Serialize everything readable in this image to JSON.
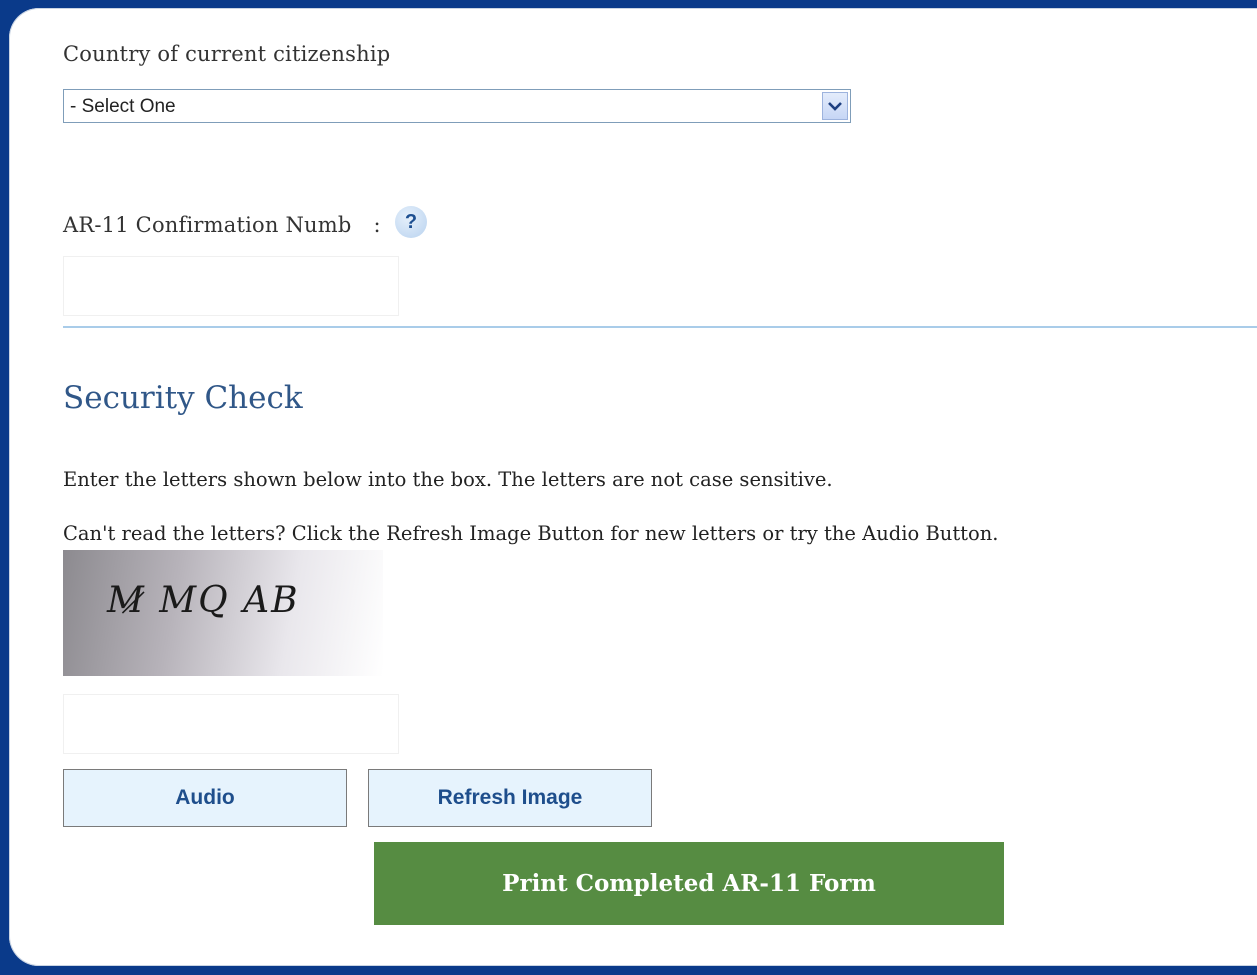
{
  "citizenship": {
    "label": "Country of current citizenship",
    "selected": "- Select One"
  },
  "confirmation": {
    "label": "AR-11 Confirmation Numb",
    "label_tail": ":",
    "help_glyph": "?",
    "value": ""
  },
  "security": {
    "title": "Security Check",
    "instruction_1": "Enter the letters shown below into the box. The letters are not case sensitive.",
    "instruction_2": "Can't read the letters? Click the Refresh Image Button for new letters or try the Audio Button.",
    "captcha_text": "M̷ MQ AB",
    "answer_value": ""
  },
  "buttons": {
    "audio": "Audio",
    "refresh": "Refresh Image",
    "print": "Print Completed AR-11 Form"
  },
  "colors": {
    "page_background": "#0a3a8a",
    "section_title": "#305788",
    "print_button": "#568c42",
    "secondary_button_bg": "#e6f3fd",
    "button_text": "#1e4e8c",
    "divider": "#a9cce9"
  },
  "icons": {
    "select_arrow": "chevron-down-icon",
    "help": "help-icon"
  }
}
